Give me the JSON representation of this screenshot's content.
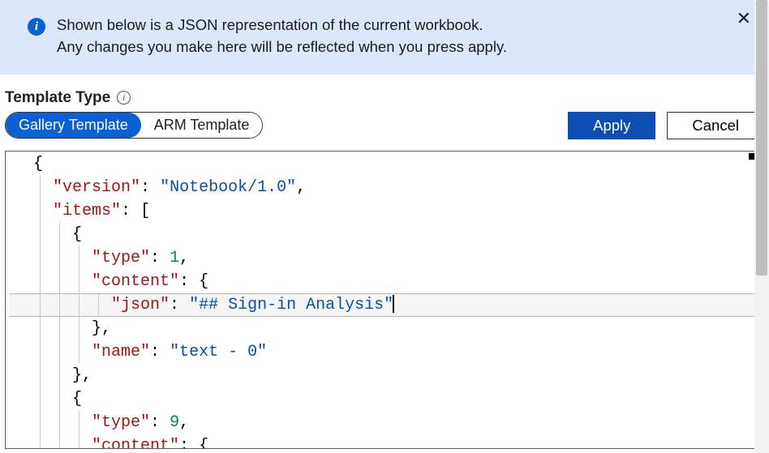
{
  "banner": {
    "line1": "Shown below is a JSON representation of the current workbook.",
    "line2": "Any changes you make here will be reflected when you press apply."
  },
  "templateTypeLabel": "Template Type",
  "segments": {
    "gallery": "Gallery Template",
    "arm": "ARM Template"
  },
  "buttons": {
    "apply": "Apply",
    "cancel": "Cancel"
  },
  "code": {
    "open_brace": "{",
    "close_brace": "}",
    "open_bracket": "[",
    "key_version": "\"version\"",
    "val_version": "\"Notebook/1.0\"",
    "key_items": "\"items\"",
    "key_type": "\"type\"",
    "val_type1": "1",
    "key_content": "\"content\"",
    "key_json": "\"json\"",
    "val_json": "\"## Sign-in Analysis\"",
    "key_name": "\"name\"",
    "val_name": "\"text - 0\"",
    "val_type9": "9",
    "colon": ":",
    "comma": ",",
    "brace_comma": "},"
  }
}
